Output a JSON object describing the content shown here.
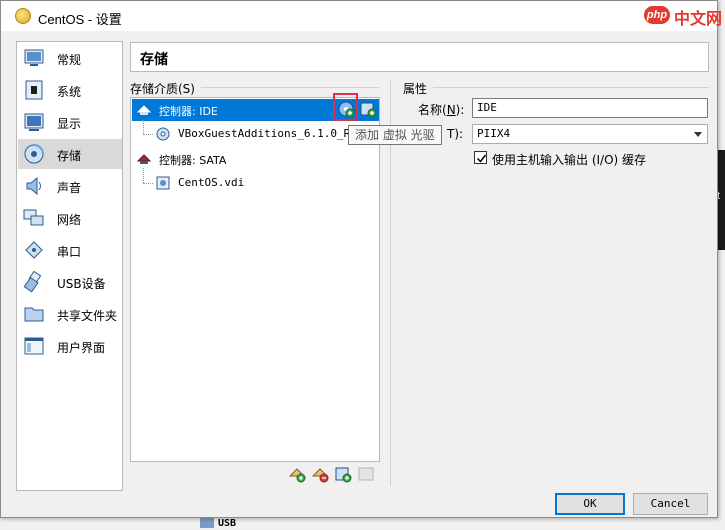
{
  "window": {
    "title": "CentOS - 设置"
  },
  "watermark": {
    "badge": "php",
    "text": "中文网"
  },
  "sidebar": {
    "items": [
      {
        "label": "常规",
        "icon": "general-icon"
      },
      {
        "label": "系统",
        "icon": "system-icon"
      },
      {
        "label": "显示",
        "icon": "display-icon"
      },
      {
        "label": "存储",
        "icon": "storage-icon",
        "active": true
      },
      {
        "label": "声音",
        "icon": "audio-icon"
      },
      {
        "label": "网络",
        "icon": "network-icon"
      },
      {
        "label": "串口",
        "icon": "serial-port-icon"
      },
      {
        "label": "USB设备",
        "icon": "usb-icon"
      },
      {
        "label": "共享文件夹",
        "icon": "shared-folder-icon"
      },
      {
        "label": "用户界面",
        "icon": "user-interface-icon"
      }
    ]
  },
  "page": {
    "title": "存储"
  },
  "storage_media": {
    "label": "存储介质(S)",
    "tree": [
      {
        "text": "控制器: IDE",
        "type": "controller",
        "selected": true
      },
      {
        "text": "VBoxGuestAdditions_6.1.0_RC1",
        "type": "optical"
      },
      {
        "text": "控制器: SATA",
        "type": "controller"
      },
      {
        "text": "CentOS.vdi",
        "type": "disk"
      }
    ],
    "tooltip": "添加 虚拟 光驱"
  },
  "attributes": {
    "label": "属性",
    "name_label_main": "名称(",
    "name_label_key": "N",
    "name_label_end": "):",
    "name_value": "IDE",
    "type_label_end": "T):",
    "type_value": "PIIX4",
    "host_io_cache_label": "使用主机输入输出 (I/O) 缓存",
    "host_io_cache_checked": true
  },
  "buttons": {
    "ok": "OK",
    "cancel": "Cancel"
  },
  "background": {
    "dark_text": "t",
    "bottom_text": "USB"
  }
}
